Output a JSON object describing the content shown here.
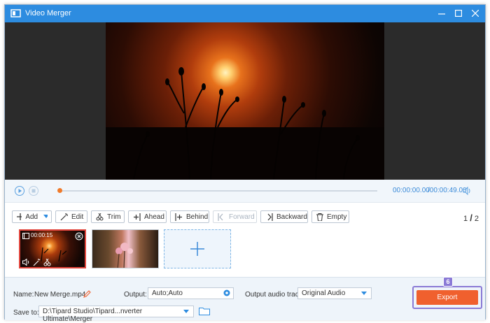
{
  "window": {
    "title": "Video Merger"
  },
  "player": {
    "current_time": "00:00:00.00",
    "total_time": "/00:00:49.00",
    "progress": 0
  },
  "toolbar": {
    "add_label": "Add",
    "edit_label": "Edit",
    "trim_label": "Trim",
    "ahead_label": "Ahead",
    "behind_label": "Behind",
    "forward_label": "Forward",
    "backward_label": "Backward",
    "empty_label": "Empty",
    "page_current": "1",
    "page_sep": "/",
    "page_total": "2"
  },
  "clips": [
    {
      "time": "00:00:15"
    }
  ],
  "settings": {
    "name_label": "Name:",
    "name_value": "New Merge.mp4",
    "output_label": "Output:",
    "output_value": "Auto;Auto",
    "audio_label": "Output audio track:",
    "audio_value": "Original Audio",
    "save_label": "Save to:",
    "save_path": "D:\\Tipard Studio\\Tipard...nverter Ultimate\\Merger"
  },
  "export": {
    "label": "Export",
    "step": "6"
  },
  "colors": {
    "titlebar": "#2d8ce0",
    "accent": "#3a8ad8",
    "export": "#f0602e",
    "highlight": "#8a7ad6"
  }
}
